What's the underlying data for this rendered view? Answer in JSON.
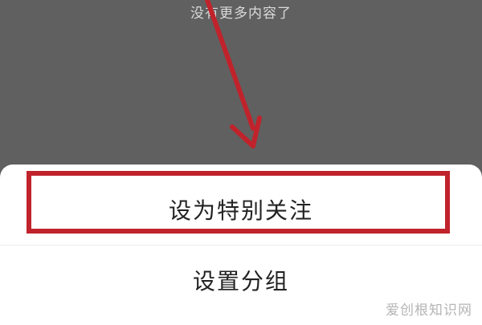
{
  "background": {
    "no_more_text": "没有更多内容了"
  },
  "action_sheet": {
    "items": [
      {
        "label": "设为特别关注"
      },
      {
        "label": "设置分组"
      }
    ]
  },
  "annotation": {
    "highlight_color": "#c0232b",
    "arrow_color": "#c0232b"
  },
  "watermark": {
    "text": "爱创根知识网"
  },
  "colors": {
    "dim_overlay": "#606060",
    "sheet_bg": "#ffffff",
    "text_primary": "#222222"
  }
}
